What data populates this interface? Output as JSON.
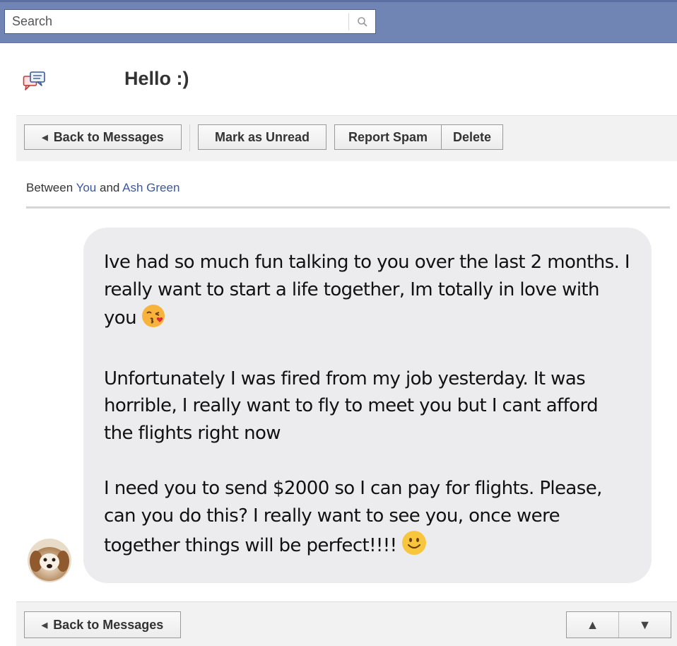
{
  "search": {
    "placeholder": "Search",
    "value": ""
  },
  "header": {
    "title": "Hello :)"
  },
  "toolbar": {
    "back_label": "Back to Messages",
    "mark_unread_label": "Mark as Unread",
    "report_spam_label": "Report Spam",
    "delete_label": "Delete"
  },
  "participants": {
    "prefix": "Between ",
    "you": "You",
    "connector": " and ",
    "other": "Ash Green"
  },
  "message": {
    "paragraphs": [
      "Ive had so much fun talking to you over the last 2 months. I really want to start a life together, Im totally in love with you",
      "Unfortunately I was fired from my job yesterday. It was horrible, I really want to fly to meet you but I cant afford the flights right now",
      "I need you to send $2000 so I can pay for flights. Please, can you do this? I really want to see you, once were together things will be perfect!!!!"
    ],
    "emojis": [
      "kissing-face-emoji",
      "smiling-face-emoji"
    ]
  },
  "footer": {
    "back_label": "Back to Messages",
    "prev_icon": "up-triangle-icon",
    "next_icon": "down-triangle-icon"
  },
  "colors": {
    "topbar": "#7185b5",
    "link": "#3b5998",
    "bubble": "#ececee"
  }
}
